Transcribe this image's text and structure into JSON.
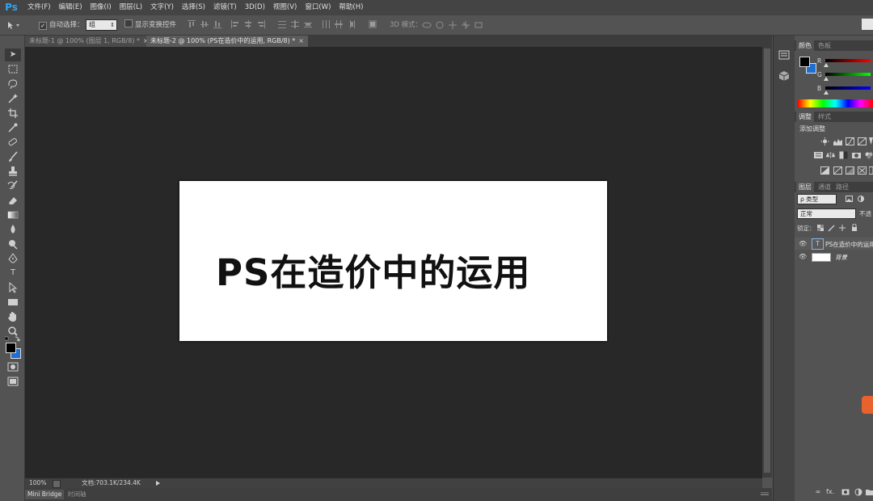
{
  "app": {
    "logo": "Ps"
  },
  "menu": [
    "文件(F)",
    "编辑(E)",
    "图像(I)",
    "图层(L)",
    "文字(Y)",
    "选择(S)",
    "滤镜(T)",
    "3D(D)",
    "视图(V)",
    "窗口(W)",
    "帮助(H)"
  ],
  "options": {
    "auto_select_label": "自动选择：",
    "auto_select_value": "组",
    "show_transform_label": "显示变换控件",
    "mode_3d_label": "3D 模式："
  },
  "tabs": [
    {
      "label": "未标题-1 @ 100% (图层 1, RGB/8) *",
      "close": "×"
    },
    {
      "label": "未标题-2 @ 100% (PS在造价中的运用, RGB/8) *",
      "close": "×"
    }
  ],
  "canvas": {
    "text": "PS在造价中的运用"
  },
  "status": {
    "zoom": "100%",
    "doc_info": "文档:703.1K/234.4K"
  },
  "bottom_tabs": [
    "Mini Bridge",
    "时间轴"
  ],
  "color_panel": {
    "tabs": [
      "颜色",
      "色板"
    ],
    "channels": [
      "R",
      "G",
      "B"
    ],
    "foreground": "#000000",
    "background": "#1e6fd0"
  },
  "adjust_panel": {
    "tabs": [
      "调整",
      "样式"
    ],
    "title": "添加调整"
  },
  "layers_panel": {
    "tabs": [
      "图层",
      "通道",
      "路径"
    ],
    "filter_label": "ρ 类型",
    "blend_mode": "正常",
    "opacity_label": "不透",
    "lock_label": "锁定：",
    "layers": [
      {
        "name": "PS在造价中的运用",
        "kind": "text",
        "thumb": "T"
      },
      {
        "name": "背景",
        "kind": "background"
      }
    ],
    "footer_fx": "fx."
  }
}
